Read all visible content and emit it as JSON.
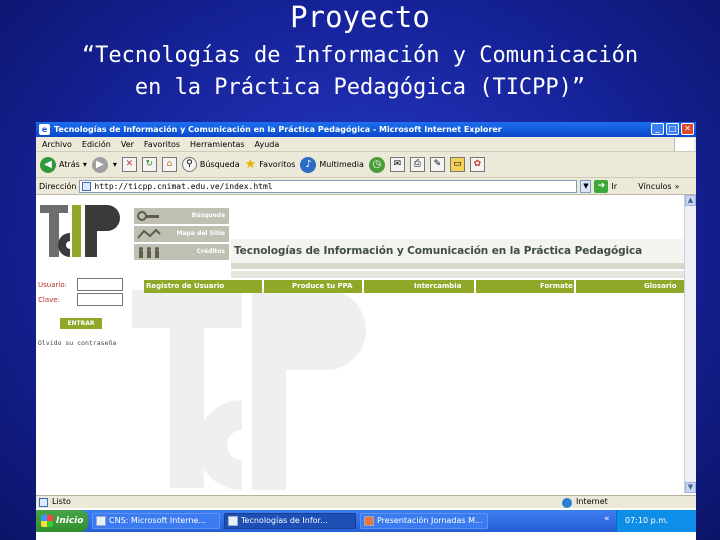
{
  "slide": {
    "title": "Proyecto",
    "subtitle_line1": "“Tecnologías de Información y Comunicación",
    "subtitle_line2": "en la Práctica Pedagógica (TICPP)”"
  },
  "browser": {
    "title": "Tecnologías de Información y Comunicación en la Práctica Pedagógica - Microsoft Internet Explorer",
    "window_buttons": {
      "minimize": "_",
      "maximize": "□",
      "close": "✕"
    },
    "menu": [
      "Archivo",
      "Edición",
      "Ver",
      "Favoritos",
      "Herramientas",
      "Ayuda"
    ],
    "toolbar": {
      "back": "Atrás",
      "search": "Búsqueda",
      "favorites": "Favoritos",
      "multimedia": "Multimedia"
    },
    "address_label": "Dirección",
    "address_value": "http://ticpp.cnimat.edu.ve/index.html",
    "go_label": "Ir",
    "links_label": "Vínculos",
    "status_text": "Listo",
    "zone_text": "Internet"
  },
  "site": {
    "side_menu": [
      "Búsqueda",
      "Mapa del Sitio",
      "Créditos"
    ],
    "banner_title": "Tecnologías de Información y Comunicación en la Práctica Pedagógica",
    "nav": [
      "Registro de Usuario",
      "Produce tu PPA",
      "Intercambia",
      "Formate",
      "Glosario"
    ],
    "login": {
      "user_label": "Usuario:",
      "pass_label": "Clave:",
      "button": "ENTRAR",
      "forgot": "Olvido su contraseña"
    }
  },
  "taskbar": {
    "start": "Inicio",
    "items": [
      "CNS: Microsoft Interne...",
      "Tecnologías de Infor...",
      "Presentación Jornadas M..."
    ],
    "active_index": 1,
    "clock": "07:10 p.m."
  },
  "colors": {
    "slide_background": "#1c2bb0",
    "nav_green": "#8fa82a",
    "xp_blue": "#235ed8"
  }
}
